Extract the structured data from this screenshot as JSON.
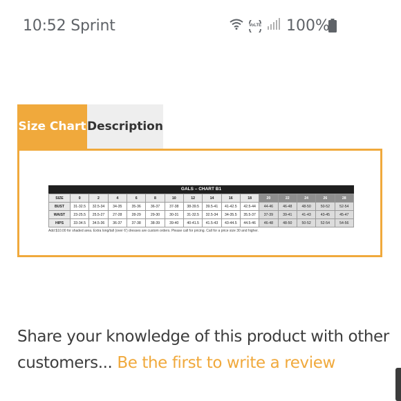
{
  "status_bar": {
    "time_carrier": "10:52 Sprint",
    "volte": "VoLTE",
    "battery": "100%"
  },
  "tabs": [
    {
      "label": "Size Chart",
      "active": true
    },
    {
      "label": "Description",
      "active": false
    }
  ],
  "size_chart": {
    "title": "GALS – CHART B1",
    "header": [
      "SIZE",
      "0",
      "2",
      "4",
      "6",
      "8",
      "10",
      "12",
      "14",
      "16",
      "18",
      "20",
      "22",
      "24",
      "26",
      "28"
    ],
    "rows": [
      [
        "BUST",
        "31-32.5",
        "32.5-34",
        "34-35",
        "35-36",
        "36-37",
        "37-38",
        "38-39.5",
        "39.5-41",
        "41-42.5",
        "42.5-44",
        "44-46",
        "46-48",
        "48-50",
        "50-52",
        "52-54"
      ],
      [
        "WAIST",
        "23-25.5",
        "25.5-27",
        "27-28",
        "28-29",
        "29-30",
        "30-31",
        "31-32.5",
        "32.5-34",
        "34-35.5",
        "35.5-37",
        "37-39",
        "39-41",
        "41-43",
        "43-45",
        "45-47"
      ],
      [
        "HIPS",
        "33-34.5",
        "34.5-36",
        "36-37",
        "37-38",
        "38-39",
        "39-40",
        "40-41.5",
        "41.5-43",
        "43-44.5",
        "44.5-46",
        "46-48",
        "48-50",
        "50-52",
        "52-54",
        "54-56"
      ]
    ],
    "note": "Add $10.00 for shaded area. Extra long/tall (over 6') dresses are custom orders. Please call for pricing. Call for a price size 30 and higher."
  },
  "review": {
    "text": "Share your knowledge of this product with other customers... ",
    "link": "Be the first to write a review"
  },
  "colors": {
    "accent": "#f0a93c",
    "tab_inactive": "#eeeeee",
    "text": "#3d3d3d"
  }
}
